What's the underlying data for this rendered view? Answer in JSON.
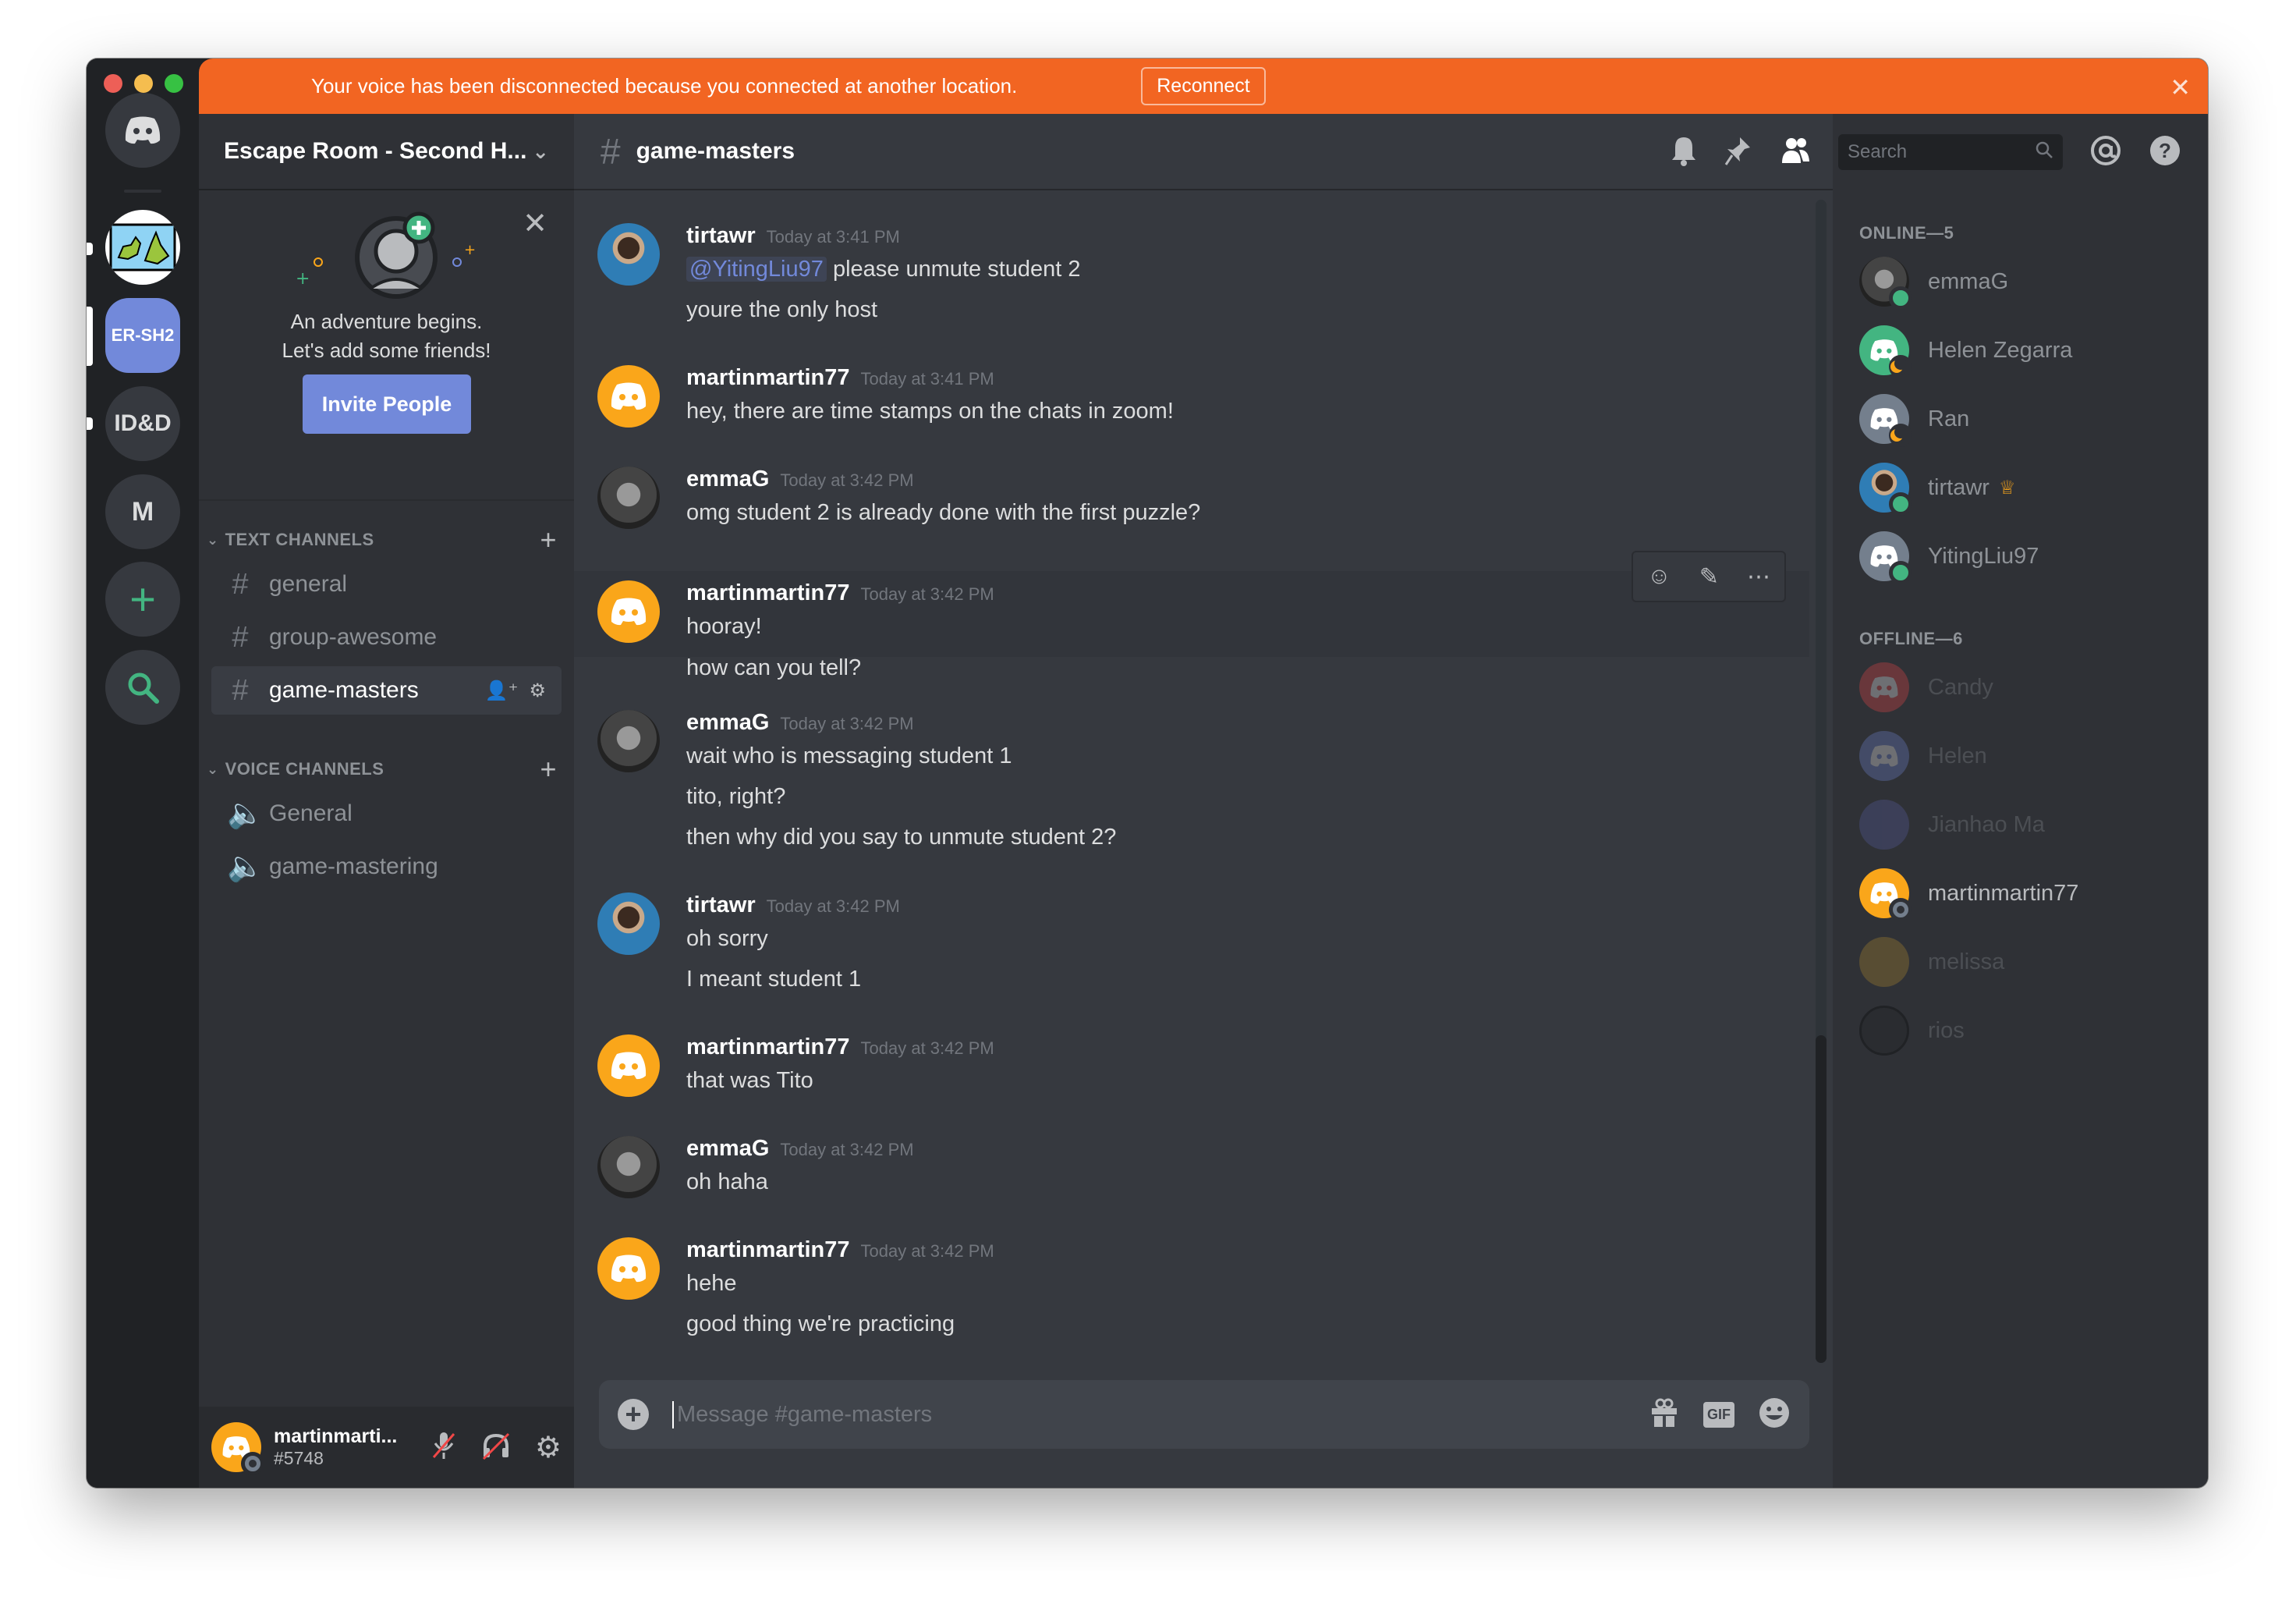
{
  "banner": {
    "message": "Your voice has been disconnected because you connected at another location.",
    "button_label": "Reconnect",
    "close_glyph": "✕",
    "color": "#f26522"
  },
  "servers": {
    "items": [
      {
        "label": "",
        "icon": "discord-home-icon"
      },
      {
        "label": "",
        "icon": "map-server-icon"
      },
      {
        "label": "ER-SH2",
        "selected": true
      },
      {
        "label": "ID&D"
      },
      {
        "label": "M"
      },
      {
        "label": "+",
        "icon": "add-server-icon"
      },
      {
        "label": "",
        "icon": "explore-icon"
      }
    ]
  },
  "guild": {
    "name": "Escape Room - Second H...",
    "invite": {
      "line1": "An adventure begins.",
      "line2": "Let's add some friends!",
      "button_label": "Invite People"
    },
    "categories": [
      {
        "label": "TEXT CHANNELS",
        "channels": [
          {
            "name": "general",
            "type": "text"
          },
          {
            "name": "group-awesome",
            "type": "text"
          },
          {
            "name": "game-masters",
            "type": "text",
            "active": true
          }
        ]
      },
      {
        "label": "VOICE CHANNELS",
        "channels": [
          {
            "name": "General",
            "type": "voice"
          },
          {
            "name": "game-mastering",
            "type": "voice"
          }
        ]
      }
    ]
  },
  "user": {
    "name": "martinmarti...",
    "tag": "#5748",
    "status": "offline"
  },
  "chat": {
    "channel": "game-masters",
    "search_placeholder": "Search",
    "composer_placeholder": "Message #game-masters",
    "messages": [
      {
        "author": "tirtawr",
        "time": "Today at 3:41 PM",
        "avatar": "photo-tirtawr",
        "mention": "@YitingLiu97",
        "lines": [
          "please unmute student 2",
          "youre the only host"
        ]
      },
      {
        "author": "martinmartin77",
        "time": "Today at 3:41 PM",
        "avatar": "discord-orange",
        "lines": [
          "hey, there are time stamps on the chats in zoom!"
        ]
      },
      {
        "author": "emmaG",
        "time": "Today at 3:42 PM",
        "avatar": "photo-emmaG",
        "lines": [
          "omg student 2 is already done with the first puzzle?"
        ]
      },
      {
        "author": "martinmartin77",
        "time": "Today at 3:42 PM",
        "avatar": "discord-orange",
        "hovered": true,
        "lines": [
          "hooray!",
          "how can you tell?"
        ]
      },
      {
        "author": "emmaG",
        "time": "Today at 3:42 PM",
        "avatar": "photo-emmaG",
        "lines": [
          "wait who is messaging student 1",
          "tito, right?",
          "then why did you say to unmute student 2?"
        ]
      },
      {
        "author": "tirtawr",
        "time": "Today at 3:42 PM",
        "avatar": "photo-tirtawr",
        "lines": [
          "oh sorry",
          "I meant student 1"
        ]
      },
      {
        "author": "martinmartin77",
        "time": "Today at 3:42 PM",
        "avatar": "discord-orange",
        "lines": [
          "that was Tito"
        ]
      },
      {
        "author": "emmaG",
        "time": "Today at 3:42 PM",
        "avatar": "photo-emmaG",
        "lines": [
          "oh haha"
        ]
      },
      {
        "author": "martinmartin77",
        "time": "Today at 3:42 PM",
        "avatar": "discord-orange",
        "lines": [
          "hehe",
          "good thing we're practicing"
        ]
      }
    ]
  },
  "members": {
    "online_label": "ONLINE—5",
    "offline_label": "OFFLINE—6",
    "online": [
      {
        "name": "emmaG",
        "status": "online",
        "avatar": "photo-emmaG"
      },
      {
        "name": "Helen Zegarra",
        "status": "idle",
        "avatar_color": "#43b581"
      },
      {
        "name": "Ran",
        "status": "idle",
        "avatar_color": "#747f8d"
      },
      {
        "name": "tirtawr",
        "status": "online",
        "avatar": "photo-tirtawr",
        "owner": true
      },
      {
        "name": "YitingLiu97",
        "status": "online",
        "avatar_color": "#747f8d"
      }
    ],
    "offline": [
      {
        "name": "Candy",
        "avatar_color": "#f04747"
      },
      {
        "name": "Helen",
        "avatar_color": "#7289da"
      },
      {
        "name": "Jianhao Ma",
        "avatar_color": "#5b5fa8"
      },
      {
        "name": "martinmartin77",
        "avatar_color": "#faa61a",
        "self": true
      },
      {
        "name": "melissa",
        "avatar_color": "#b8902e"
      },
      {
        "name": "rios",
        "avatar_color": "#202225"
      }
    ]
  }
}
